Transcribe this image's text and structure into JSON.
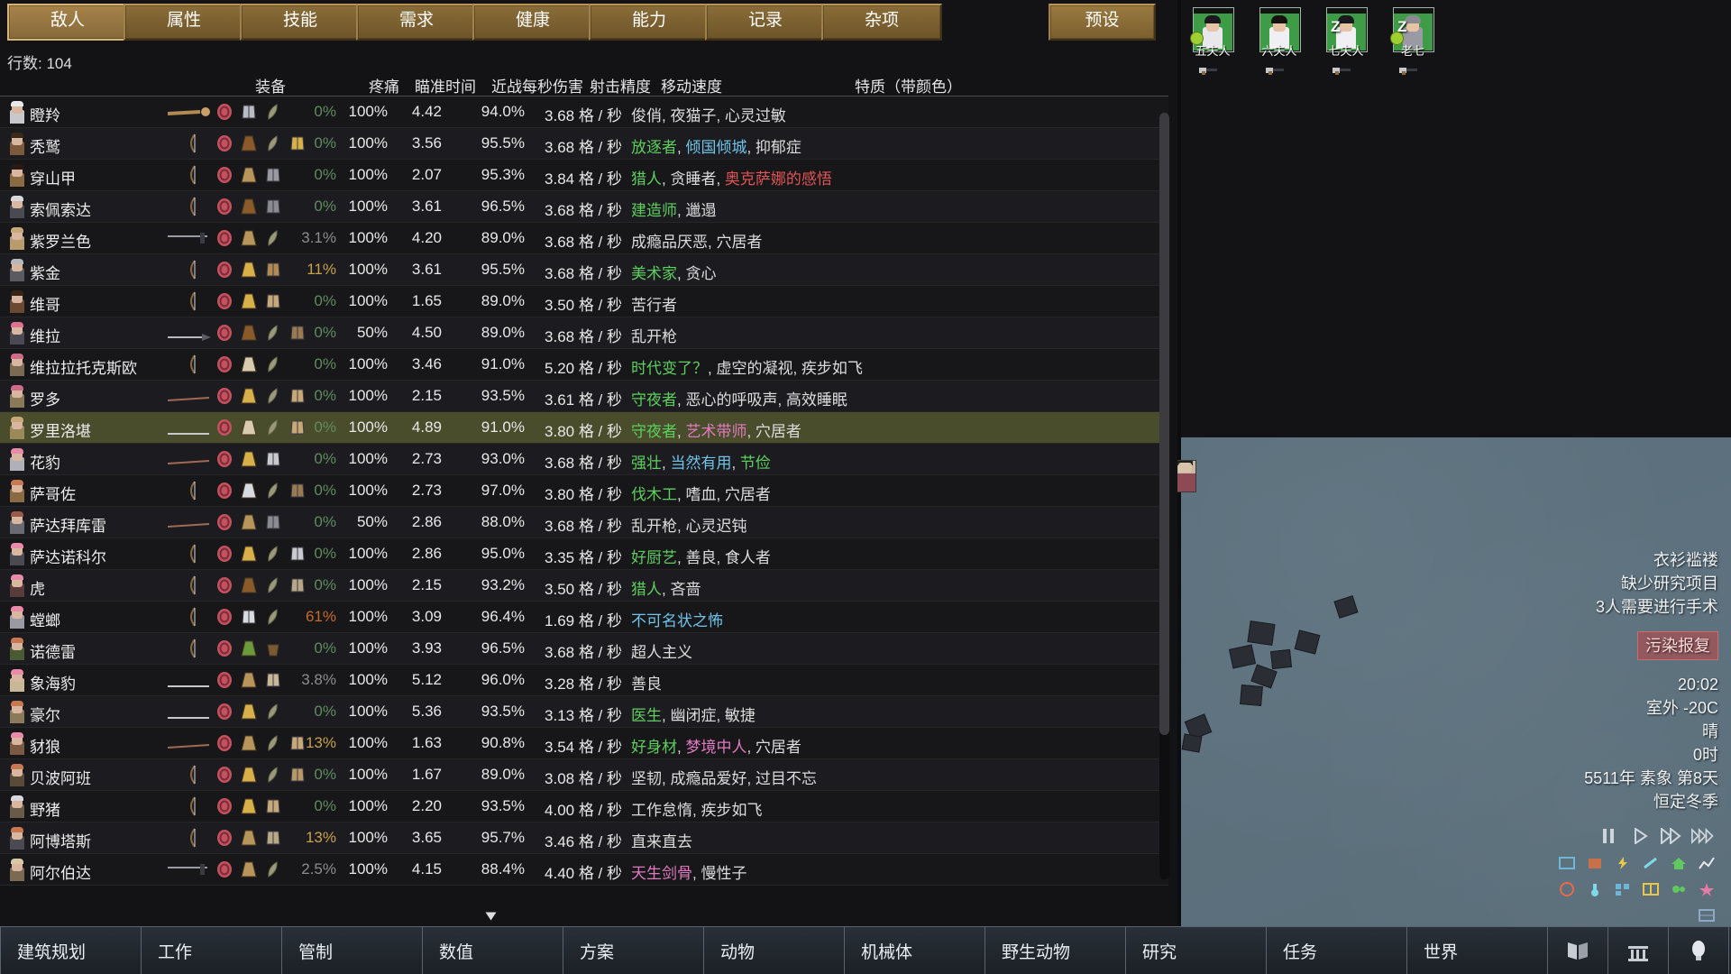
{
  "tabs": [
    {
      "label": "敌人",
      "active": true
    },
    {
      "label": "属性",
      "active": false
    },
    {
      "label": "技能",
      "active": false
    },
    {
      "label": "需求",
      "active": false
    },
    {
      "label": "健康",
      "active": false
    },
    {
      "label": "能力",
      "active": false
    },
    {
      "label": "记录",
      "active": false
    },
    {
      "label": "杂项",
      "active": false
    }
  ],
  "preset_button": "预设",
  "row_count_label": "行数: 104",
  "columns": {
    "gear": "装备",
    "pain": "疼痛",
    "aim_time": "瞄准时间",
    "melee_dps": "近战每秒伤害",
    "shooting_accuracy": "射击精度",
    "move_speed": "移动速度",
    "traits": "特质（带颜色）"
  },
  "rows": [
    {
      "name": "瞪羚",
      "pain": "0%",
      "pain_cls": "pain-zero",
      "aim": "100%",
      "melee": "4.42",
      "acc": "94.0%",
      "speed": "3.68 格 / 秒",
      "traits": [
        {
          "t": "俊俏",
          "c": "t-plain"
        },
        {
          "t": ", ",
          "c": "t-plain"
        },
        {
          "t": "夜猫子",
          "c": "t-plain"
        },
        {
          "t": ", ",
          "c": "t-plain"
        },
        {
          "t": "心灵过敏",
          "c": "t-plain"
        }
      ],
      "weapon": "club",
      "apparel": [
        "hat",
        "shirt",
        "leaf"
      ],
      "body": "#c8c8cc",
      "hair": "#e8e8ec"
    },
    {
      "name": "秃鹫",
      "pain": "0%",
      "pain_cls": "pain-zero",
      "aim": "100%",
      "melee": "3.56",
      "acc": "95.5%",
      "speed": "3.68 格 / 秒",
      "traits": [
        {
          "t": "放逐者",
          "c": "t-green"
        },
        {
          "t": ", ",
          "c": "t-plain"
        },
        {
          "t": "倾国倾城",
          "c": "t-blue"
        },
        {
          "t": ", ",
          "c": "t-plain"
        },
        {
          "t": "抑郁症",
          "c": "t-plain"
        }
      ],
      "weapon": "bow",
      "apparel": [
        "hat",
        "duster-brown",
        "leaf",
        "pants"
      ],
      "body": "#7a5a3a",
      "hair": "#3a2a1a"
    },
    {
      "name": "穿山甲",
      "pain": "0%",
      "pain_cls": "pain-zero",
      "aim": "100%",
      "melee": "2.07",
      "acc": "95.3%",
      "speed": "3.84 格 / 秒",
      "traits": [
        {
          "t": "猎人",
          "c": "t-green"
        },
        {
          "t": ", ",
          "c": "t-plain"
        },
        {
          "t": "贪睡者",
          "c": "t-plain"
        },
        {
          "t": ", ",
          "c": "t-plain"
        },
        {
          "t": "奥克萨娜的感悟",
          "c": "t-red"
        }
      ],
      "weapon": "bow",
      "apparel": [
        "hat",
        "duster-tan",
        "shirt2"
      ],
      "body": "#8a6a42",
      "hair": "#2a1a12"
    },
    {
      "name": "索佩索达",
      "pain": "0%",
      "pain_cls": "pain-zero",
      "aim": "100%",
      "melee": "3.61",
      "acc": "96.5%",
      "speed": "3.68 格 / 秒",
      "traits": [
        {
          "t": "建造师",
          "c": "t-green"
        },
        {
          "t": ", ",
          "c": "t-plain"
        },
        {
          "t": "邋遢",
          "c": "t-plain"
        }
      ],
      "weapon": "bow",
      "apparel": [
        "hat",
        "duster-brown",
        "vest-grey"
      ],
      "body": "#4a4a52",
      "hair": "#d8d8dc"
    },
    {
      "name": "紫罗兰色",
      "pain": "3.1%",
      "pain_cls": "pain-low",
      "aim": "100%",
      "melee": "4.20",
      "acc": "89.0%",
      "speed": "3.68 格 / 秒",
      "traits": [
        {
          "t": "成瘾品厌恶",
          "c": "t-plain"
        },
        {
          "t": ", ",
          "c": "t-plain"
        },
        {
          "t": "穴居者",
          "c": "t-plain"
        }
      ],
      "weapon": "axe",
      "apparel": [
        "hat",
        "duster-tan",
        "leaf"
      ],
      "body": "#b89c6e",
      "hair": "#c8a878"
    },
    {
      "name": "紫金",
      "pain": "11%",
      "pain_cls": "pain-mid",
      "aim": "100%",
      "melee": "3.61",
      "acc": "95.5%",
      "speed": "3.68 格 / 秒",
      "traits": [
        {
          "t": "美术家",
          "c": "t-green"
        },
        {
          "t": ", ",
          "c": "t-plain"
        },
        {
          "t": "贪心",
          "c": "t-plain"
        }
      ],
      "weapon": "bow",
      "apparel": [
        "hat",
        "duster-gold",
        "shirt3"
      ],
      "body": "#5a5a60",
      "hair": "#b8b8bc"
    },
    {
      "name": "维哥",
      "pain": "0%",
      "pain_cls": "pain-zero",
      "aim": "100%",
      "melee": "1.65",
      "acc": "89.0%",
      "speed": "3.50 格 / 秒",
      "traits": [
        {
          "t": "苦行者",
          "c": "t-plain"
        }
      ],
      "weapon": "bow2",
      "apparel": [
        "hat",
        "duster-gold",
        "shirt4"
      ],
      "body": "#6a4a32",
      "hair": "#3a2418"
    },
    {
      "name": "维拉",
      "pain": "0%",
      "pain_cls": "pain-zero",
      "aim": "50%",
      "melee": "4.50",
      "acc": "89.0%",
      "speed": "3.68 格 / 秒",
      "traits": [
        {
          "t": "乱开枪",
          "c": "t-plain"
        }
      ],
      "weapon": "spear",
      "apparel": [
        "hat",
        "duster-brown",
        "leaf",
        "vest2"
      ],
      "body": "#4a4a54",
      "hair": "#e07090"
    },
    {
      "name": "维拉拉托克斯欧",
      "pain": "0%",
      "pain_cls": "pain-zero",
      "aim": "100%",
      "melee": "3.46",
      "acc": "91.0%",
      "speed": "5.20 格 / 秒",
      "traits": [
        {
          "t": "时代变了？",
          "c": "t-green"
        },
        {
          "t": ", ",
          "c": "t-plain"
        },
        {
          "t": "虚空的凝视",
          "c": "t-plain"
        },
        {
          "t": ", ",
          "c": "t-plain"
        },
        {
          "t": "疾步如飞",
          "c": "t-plain"
        }
      ],
      "weapon": "bow",
      "apparel": [
        "hat",
        "duster-cream",
        "leaf"
      ],
      "body": "#7a6a52",
      "hair": "#d06a8a"
    },
    {
      "name": "罗多",
      "pain": "0%",
      "pain_cls": "pain-zero",
      "aim": "100%",
      "melee": "2.15",
      "acc": "93.5%",
      "speed": "3.61 格 / 秒",
      "traits": [
        {
          "t": "守夜者",
          "c": "t-green"
        },
        {
          "t": ", ",
          "c": "t-plain"
        },
        {
          "t": "恶心的呼吸声",
          "c": "t-plain"
        },
        {
          "t": ", ",
          "c": "t-plain"
        },
        {
          "t": "高效睡眠",
          "c": "t-plain"
        }
      ],
      "weapon": "club2",
      "apparel": [
        "hat",
        "duster-gold",
        "leaf",
        "shirt5"
      ],
      "body": "#8a7a5a",
      "hair": "#d06a8a"
    },
    {
      "name": "罗里洛堪",
      "pain": "0%",
      "pain_cls": "pain-zero",
      "aim": "100%",
      "melee": "4.89",
      "acc": "91.0%",
      "speed": "3.80 格 / 秒",
      "traits": [
        {
          "t": "守夜者",
          "c": "t-green"
        },
        {
          "t": ", ",
          "c": "t-plain"
        },
        {
          "t": "艺术带师",
          "c": "t-pink"
        },
        {
          "t": ", ",
          "c": "t-plain"
        },
        {
          "t": "穴居者",
          "c": "t-plain"
        }
      ],
      "weapon": "rod",
      "apparel": [
        "hat",
        "duster-cream",
        "leaf",
        "pants2"
      ],
      "selected": true,
      "body": "#9a8a5a",
      "hair": "#c8a878"
    },
    {
      "name": "花豹",
      "pain": "0%",
      "pain_cls": "pain-zero",
      "aim": "100%",
      "melee": "2.73",
      "acc": "93.0%",
      "speed": "3.68 格 / 秒",
      "traits": [
        {
          "t": "强壮",
          "c": "t-green"
        },
        {
          "t": ", ",
          "c": "t-plain"
        },
        {
          "t": "当然有用",
          "c": "t-blue"
        },
        {
          "t": ", ",
          "c": "t-plain"
        },
        {
          "t": "节俭",
          "c": "t-green"
        }
      ],
      "weapon": "club2",
      "apparel": [
        "hat",
        "duster-gold",
        "shirt6"
      ],
      "body": "#b0b0b8",
      "hair": "#e88aa8"
    },
    {
      "name": "萨哥佐",
      "pain": "0%",
      "pain_cls": "pain-zero",
      "aim": "100%",
      "melee": "2.73",
      "acc": "97.0%",
      "speed": "3.80 格 / 秒",
      "traits": [
        {
          "t": "伐木工",
          "c": "t-green"
        },
        {
          "t": ", ",
          "c": "t-plain"
        },
        {
          "t": "嗜血",
          "c": "t-plain"
        },
        {
          "t": ", ",
          "c": "t-plain"
        },
        {
          "t": "穴居者",
          "c": "t-plain"
        }
      ],
      "weapon": "bow",
      "apparel": [
        "hat",
        "duster-white",
        "leaf",
        "shirt7"
      ],
      "body": "#8a6a42",
      "hair": "#c87850"
    },
    {
      "name": "萨达拜库雷",
      "pain": "0%",
      "pain_cls": "pain-zero",
      "aim": "50%",
      "melee": "2.86",
      "acc": "88.0%",
      "speed": "3.68 格 / 秒",
      "traits": [
        {
          "t": "乱开枪",
          "c": "t-plain"
        },
        {
          "t": ", ",
          "c": "t-plain"
        },
        {
          "t": "心灵迟钝",
          "c": "t-plain"
        }
      ],
      "weapon": "club2",
      "apparel": [
        "hat",
        "duster-tan",
        "vest3"
      ],
      "body": "#6a6a72",
      "hair": "#9a5a4a"
    },
    {
      "name": "萨达诺科尔",
      "pain": "0%",
      "pain_cls": "pain-zero",
      "aim": "100%",
      "melee": "2.86",
      "acc": "95.0%",
      "speed": "3.35 格 / 秒",
      "traits": [
        {
          "t": "好厨艺",
          "c": "t-green"
        },
        {
          "t": ", ",
          "c": "t-plain"
        },
        {
          "t": "善良",
          "c": "t-plain"
        },
        {
          "t": ", ",
          "c": "t-plain"
        },
        {
          "t": "食人者",
          "c": "t-plain"
        }
      ],
      "weapon": "bow2",
      "apparel": [
        "hat",
        "duster-gold",
        "leaf",
        "vest4"
      ],
      "body": "#4a4a52",
      "hair": "#e88aa8"
    },
    {
      "name": "虎",
      "pain": "0%",
      "pain_cls": "pain-zero",
      "aim": "100%",
      "melee": "2.15",
      "acc": "93.2%",
      "speed": "3.50 格 / 秒",
      "traits": [
        {
          "t": "猎人",
          "c": "t-green"
        },
        {
          "t": ", ",
          "c": "t-plain"
        },
        {
          "t": "吝啬",
          "c": "t-plain"
        }
      ],
      "weapon": "bow",
      "apparel": [
        "hat",
        "duster-brown",
        "leaf",
        "vest5"
      ],
      "body": "#5a3a3a",
      "hair": "#e88aa8"
    },
    {
      "name": "螳螂",
      "pain": "61%",
      "pain_cls": "pain-vhigh",
      "aim": "100%",
      "melee": "3.09",
      "acc": "96.4%",
      "speed": "1.69 格 / 秒",
      "traits": [
        {
          "t": "不可名状之怖",
          "c": "t-blue"
        }
      ],
      "weapon": "bow",
      "apparel": [
        "hat",
        "vest-white",
        "leaf"
      ],
      "body": "#9a9aa2",
      "hair": "#e88aa8"
    },
    {
      "name": "诺德雷",
      "pain": "0%",
      "pain_cls": "pain-zero",
      "aim": "100%",
      "melee": "3.93",
      "acc": "96.5%",
      "speed": "3.68 格 / 秒",
      "traits": [
        {
          "t": "超人主义",
          "c": "t-plain"
        }
      ],
      "weapon": "bow",
      "apparel": [
        "hat",
        "duster-green",
        "bucket"
      ],
      "body": "#4a5a32",
      "hair": "#c87850"
    },
    {
      "name": "象海豹",
      "pain": "3.8%",
      "pain_cls": "pain-low",
      "aim": "100%",
      "melee": "5.12",
      "acc": "96.0%",
      "speed": "3.28 格 / 秒",
      "traits": [
        {
          "t": "善良",
          "c": "t-plain"
        }
      ],
      "weapon": "line",
      "apparel": [
        "hat",
        "duster-tan",
        "shirt8"
      ],
      "body": "#c8b898",
      "hair": "#e88aa8"
    },
    {
      "name": "豪尔",
      "pain": "0%",
      "pain_cls": "pain-zero",
      "aim": "100%",
      "melee": "5.36",
      "acc": "93.5%",
      "speed": "3.13 格 / 秒",
      "traits": [
        {
          "t": "医生",
          "c": "t-green"
        },
        {
          "t": ", ",
          "c": "t-plain"
        },
        {
          "t": "幽闭症",
          "c": "t-plain"
        },
        {
          "t": ", ",
          "c": "t-plain"
        },
        {
          "t": "敏捷",
          "c": "t-plain"
        }
      ],
      "weapon": "line",
      "apparel": [
        "hat",
        "duster-gold",
        "leaf"
      ],
      "body": "#8a7a5a",
      "hair": "#c87850"
    },
    {
      "name": "豺狼",
      "pain": "13%",
      "pain_cls": "pain-mid",
      "aim": "100%",
      "melee": "1.63",
      "acc": "90.8%",
      "speed": "3.54 格 / 秒",
      "traits": [
        {
          "t": "好身材",
          "c": "t-green"
        },
        {
          "t": ", ",
          "c": "t-plain"
        },
        {
          "t": "梦境中人",
          "c": "t-pink"
        },
        {
          "t": ", ",
          "c": "t-plain"
        },
        {
          "t": "穴居者",
          "c": "t-plain"
        }
      ],
      "weapon": "club2",
      "apparel": [
        "hat",
        "duster-tan",
        "leaf",
        "shirt9"
      ],
      "body": "#7a5a42",
      "hair": "#e88aa8"
    },
    {
      "name": "贝波阿班",
      "pain": "0%",
      "pain_cls": "pain-zero",
      "aim": "100%",
      "melee": "1.67",
      "acc": "89.0%",
      "speed": "3.08 格 / 秒",
      "traits": [
        {
          "t": "坚韧",
          "c": "t-plain"
        },
        {
          "t": ", ",
          "c": "t-plain"
        },
        {
          "t": "成瘾品爱好",
          "c": "t-plain"
        },
        {
          "t": ", ",
          "c": "t-plain"
        },
        {
          "t": "过目不忘",
          "c": "t-plain"
        }
      ],
      "weapon": "bow2",
      "apparel": [
        "hat",
        "duster-gold",
        "leaf",
        "shirt10"
      ],
      "body": "#5a4a3a",
      "hair": "#c87850"
    },
    {
      "name": "野猪",
      "pain": "0%",
      "pain_cls": "pain-zero",
      "aim": "100%",
      "melee": "2.20",
      "acc": "93.5%",
      "speed": "4.00 格 / 秒",
      "traits": [
        {
          "t": "工作怠惰",
          "c": "t-plain"
        },
        {
          "t": ", ",
          "c": "t-plain"
        },
        {
          "t": "疾步如飞",
          "c": "t-plain"
        }
      ],
      "weapon": "bow2",
      "apparel": [
        "hat",
        "duster-gold",
        "shirt11"
      ],
      "body": "#6a5a4a",
      "hair": "#d8d8dc"
    },
    {
      "name": "阿博塔斯",
      "pain": "13%",
      "pain_cls": "pain-mid",
      "aim": "100%",
      "melee": "3.65",
      "acc": "95.7%",
      "speed": "3.46 格 / 秒",
      "traits": [
        {
          "t": "直来直去",
          "c": "t-plain"
        }
      ],
      "weapon": "bow2",
      "apparel": [
        "hat",
        "duster-tan",
        "shirt12"
      ],
      "body": "#4a4a52",
      "hair": "#c87850"
    },
    {
      "name": "阿尔伯达",
      "pain": "2.5%",
      "pain_cls": "pain-low",
      "aim": "100%",
      "melee": "4.15",
      "acc": "88.4%",
      "speed": "4.40 格 / 秒",
      "traits": [
        {
          "t": "天生剑骨",
          "c": "t-pink"
        },
        {
          "t": ", ",
          "c": "t-plain"
        },
        {
          "t": "慢性子",
          "c": "t-plain"
        }
      ],
      "weapon": "axe",
      "apparel": [
        "hat",
        "duster-tan",
        "leaf"
      ],
      "body": "#7a6a52",
      "hair": "#d8c8a8"
    }
  ],
  "colonists": [
    {
      "name": "五夫人",
      "asleep": false,
      "sick": true,
      "hair": "#1a1a1e",
      "body": "#e8e8ec"
    },
    {
      "name": "六夫人",
      "asleep": false,
      "sick": false,
      "hair": "#15120f",
      "body": "#f0f0f4"
    },
    {
      "name": "七夫人",
      "asleep": true,
      "sick": false,
      "hair": "#1a1a1e",
      "body": "#f0f0f4"
    },
    {
      "name": "老七",
      "asleep": true,
      "sick": true,
      "hair": "#8a8a92",
      "body": "#9a9aa4"
    }
  ],
  "alerts": [
    "衣衫褴褛",
    "缺少研究项目",
    "3人需要进行手术"
  ],
  "critical_alert": "污染报复",
  "clock": {
    "time": "20:02",
    "temperature": "室外 -20C",
    "weather": "晴",
    "hour": "0时",
    "date": "5511年 素象 第8天",
    "season": "恒定冬季"
  },
  "bottom_bar": {
    "buttons": [
      "建筑规划",
      "工作",
      "管制",
      "数值",
      "方案",
      "动物",
      "机械体",
      "野生动物",
      "研究",
      "任务",
      "世界"
    ],
    "icons": [
      "book-icon",
      "architect-icon",
      "light-bulb-icon",
      "idea-icon",
      "clean-icon",
      "menu-icon"
    ]
  },
  "speed_controls": [
    "pause-icon",
    "play-icon",
    "fast-forward-icon",
    "ultra-fast-icon"
  ]
}
